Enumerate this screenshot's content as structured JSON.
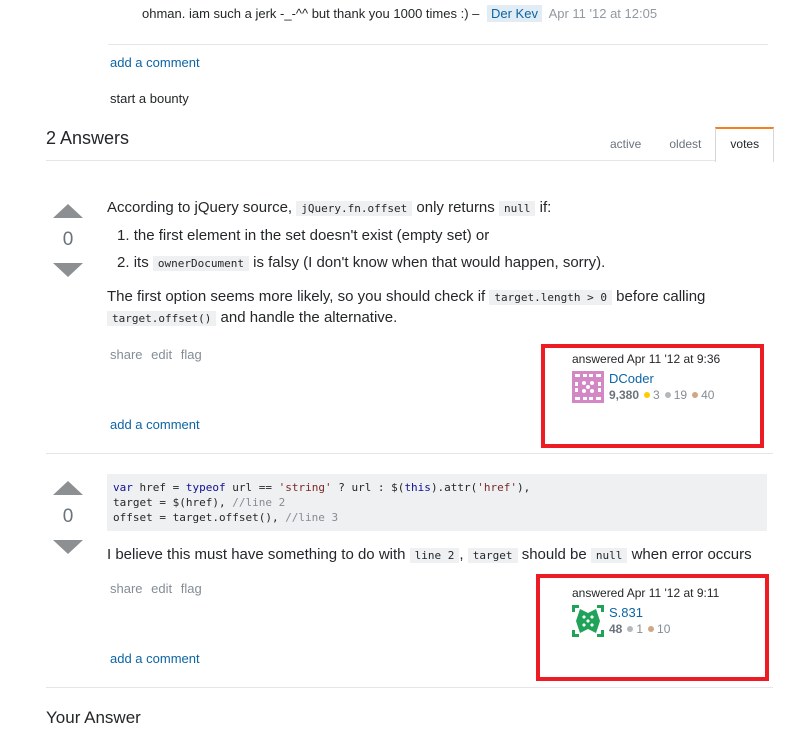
{
  "top_comment": {
    "text": "ohman. iam such a jerk -_-^^ but thank you 1000 times :) –",
    "user": "Der Kev",
    "date": "Apr 11 '12 at 12:05"
  },
  "question_footer": {
    "add_comment": "add a comment",
    "bounty": "start a bounty"
  },
  "answers_header": {
    "title": "2 Answers",
    "tabs": [
      {
        "label": "active",
        "active": false
      },
      {
        "label": "oldest",
        "active": false
      },
      {
        "label": "votes",
        "active": true
      }
    ]
  },
  "answers": [
    {
      "votes": "0",
      "intro_before": "According to jQuery source,",
      "intro_code1": "jQuery.fn.offset",
      "intro_mid": "only returns",
      "intro_code2": "null",
      "intro_after": "if:",
      "list": [
        {
          "num": "1.",
          "text": "the first element in the set doesn't exist (empty set) or"
        },
        {
          "num": "2.",
          "before": "its",
          "code": "ownerDocument",
          "after": "is falsy (I don't know when that would happen, sorry)."
        }
      ],
      "para_before": "The first option seems more likely, so you should check if",
      "para_code1": "target.length > 0",
      "para_mid": "before calling",
      "para_code2": "target.offset()",
      "para_after": "and handle the alternative.",
      "menu": [
        "share",
        "edit",
        "flag"
      ],
      "add_comment": "add a comment",
      "signature": {
        "answered": "answered Apr 11 '12 at 9:36",
        "user": "DCoder",
        "reputation": "9,380",
        "badges": [
          {
            "type": "gold",
            "count": "3",
            "color": "#ffcc01"
          },
          {
            "type": "silver",
            "count": "19",
            "color": "#b4b8bc"
          },
          {
            "type": "bronze",
            "count": "40",
            "color": "#d1a684"
          }
        ],
        "avatar_color": "#d387c5"
      }
    },
    {
      "votes": "0",
      "code_lines": [
        {
          "kw1": "var",
          "t1": " href = ",
          "kw2": "typeof",
          "t2": " url == ",
          "str1": "'string'",
          "t3": " ? url : $(",
          "kw3": "this",
          "t4": ").attr(",
          "str2": "'href'",
          "t5": "),"
        },
        {
          "t1": "target = $(href), ",
          "cm": "//line 2"
        },
        {
          "t1": "offset = target.offset(), ",
          "cm": "//line 3"
        }
      ],
      "text_before": "I believe this must have something to do with",
      "text_code1": "line 2",
      "text_sep": ",",
      "text_code2": "target",
      "text_mid": "should be",
      "text_code3": "null",
      "text_after": "when error occurs",
      "menu": [
        "share",
        "edit",
        "flag"
      ],
      "add_comment": "add a comment",
      "signature": {
        "answered": "answered Apr 11 '12 at 9:11",
        "user": "S.831",
        "reputation": "48",
        "badges": [
          {
            "type": "silver",
            "count": "1",
            "color": "#b4b8bc"
          },
          {
            "type": "bronze",
            "count": "10",
            "color": "#d1a684"
          }
        ],
        "avatar_color": "#1ea359"
      }
    }
  ],
  "your_answer": "Your Answer",
  "highlight_color": "#ed1c24"
}
